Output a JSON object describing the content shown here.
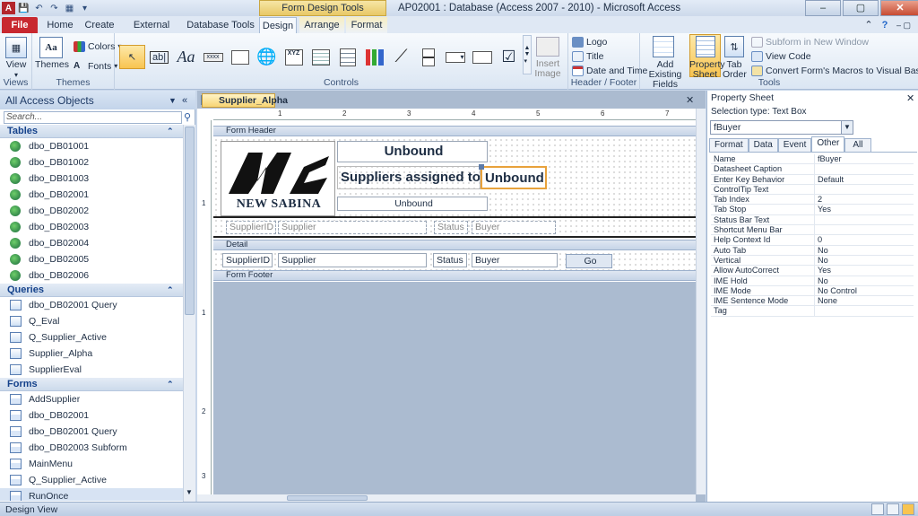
{
  "window": {
    "context_header": "Form Design Tools",
    "title": "AP02001 : Database (Access 2007 - 2010)  -  Microsoft Access"
  },
  "tabs": [
    "File",
    "Home",
    "Create",
    "External Data",
    "Database Tools",
    "Design",
    "Arrange",
    "Format"
  ],
  "ribbon": {
    "views": {
      "label": "View",
      "group": "Views"
    },
    "themes": {
      "themes_label": "Themes",
      "colors_label": "Colors",
      "fonts_label": "Fonts",
      "group": "Themes"
    },
    "controls": {
      "group": "Controls",
      "insert_image": "Insert Image"
    },
    "header_footer": {
      "logo": "Logo",
      "title": "Title",
      "date_time": "Date and Time",
      "group": "Header / Footer"
    },
    "tools": {
      "add_existing_fields": "Add Existing Fields",
      "property_sheet": "Property Sheet",
      "tab_order": "Tab Order",
      "subform": "Subform in New Window",
      "view_code": "View Code",
      "convert_macros": "Convert Form's Macros to Visual Basic",
      "group": "Tools"
    }
  },
  "nav": {
    "header": "All Access Objects",
    "search_placeholder": "Search...",
    "sections": [
      {
        "title": "Tables",
        "items": [
          "dbo_DB01001",
          "dbo_DB01002",
          "dbo_DB01003",
          "dbo_DB02001",
          "dbo_DB02002",
          "dbo_DB02003",
          "dbo_DB02004",
          "dbo_DB02005",
          "dbo_DB02006"
        ]
      },
      {
        "title": "Queries",
        "items": [
          "dbo_DB02001 Query",
          "Q_Eval",
          "Q_Supplier_Active",
          "Supplier_Alpha",
          "SupplierEval"
        ]
      },
      {
        "title": "Forms",
        "items": [
          "AddSupplier",
          "dbo_DB02001",
          "dbo_DB02001 Query",
          "dbo_DB02003 Subform",
          "MainMenu",
          "Q_Supplier_Active",
          "RunOnce"
        ]
      }
    ]
  },
  "document": {
    "tab": "Supplier_Alpha",
    "bands": {
      "header": "Form Header",
      "detail": "Detail",
      "footer": "Form Footer"
    },
    "logo_text": "NEW SABINA",
    "header_controls": {
      "unbound_top": "Unbound",
      "suppliers_label": "Suppliers  assigned to",
      "unbound_selected": "Unbound",
      "unbound_small": "Unbound",
      "col_supplierid": "SupplierID",
      "col_supplier": "Supplier",
      "col_status": "Status",
      "col_buyer": "Buyer"
    },
    "detail_controls": {
      "supplierid": "SupplierID",
      "supplier": "Supplier",
      "status": "Status",
      "buyer": "Buyer",
      "go": "Go"
    },
    "ruler_ticks": [
      "1",
      "2",
      "3",
      "4",
      "5",
      "6",
      "7"
    ],
    "vruler_ticks": [
      "1",
      "1",
      "2",
      "3"
    ]
  },
  "property_sheet": {
    "title": "Property Sheet",
    "selection_type": "Selection type:  Text Box",
    "selected_control": "fBuyer",
    "tabs": [
      "Format",
      "Data",
      "Event",
      "Other",
      "All"
    ],
    "active_tab": "Other",
    "rows": [
      [
        "Name",
        "fBuyer"
      ],
      [
        "Datasheet Caption",
        ""
      ],
      [
        "Enter Key Behavior",
        "Default"
      ],
      [
        "ControlTip Text",
        ""
      ],
      [
        "Tab Index",
        "2"
      ],
      [
        "Tab Stop",
        "Yes"
      ],
      [
        "Status Bar Text",
        ""
      ],
      [
        "Shortcut Menu Bar",
        ""
      ],
      [
        "Help Context Id",
        "0"
      ],
      [
        "Auto Tab",
        "No"
      ],
      [
        "Vertical",
        "No"
      ],
      [
        "Allow AutoCorrect",
        "Yes"
      ],
      [
        "IME Hold",
        "No"
      ],
      [
        "IME Mode",
        "No Control"
      ],
      [
        "IME Sentence Mode",
        "None"
      ],
      [
        "Tag",
        ""
      ]
    ]
  },
  "status": {
    "text": "Design View"
  }
}
